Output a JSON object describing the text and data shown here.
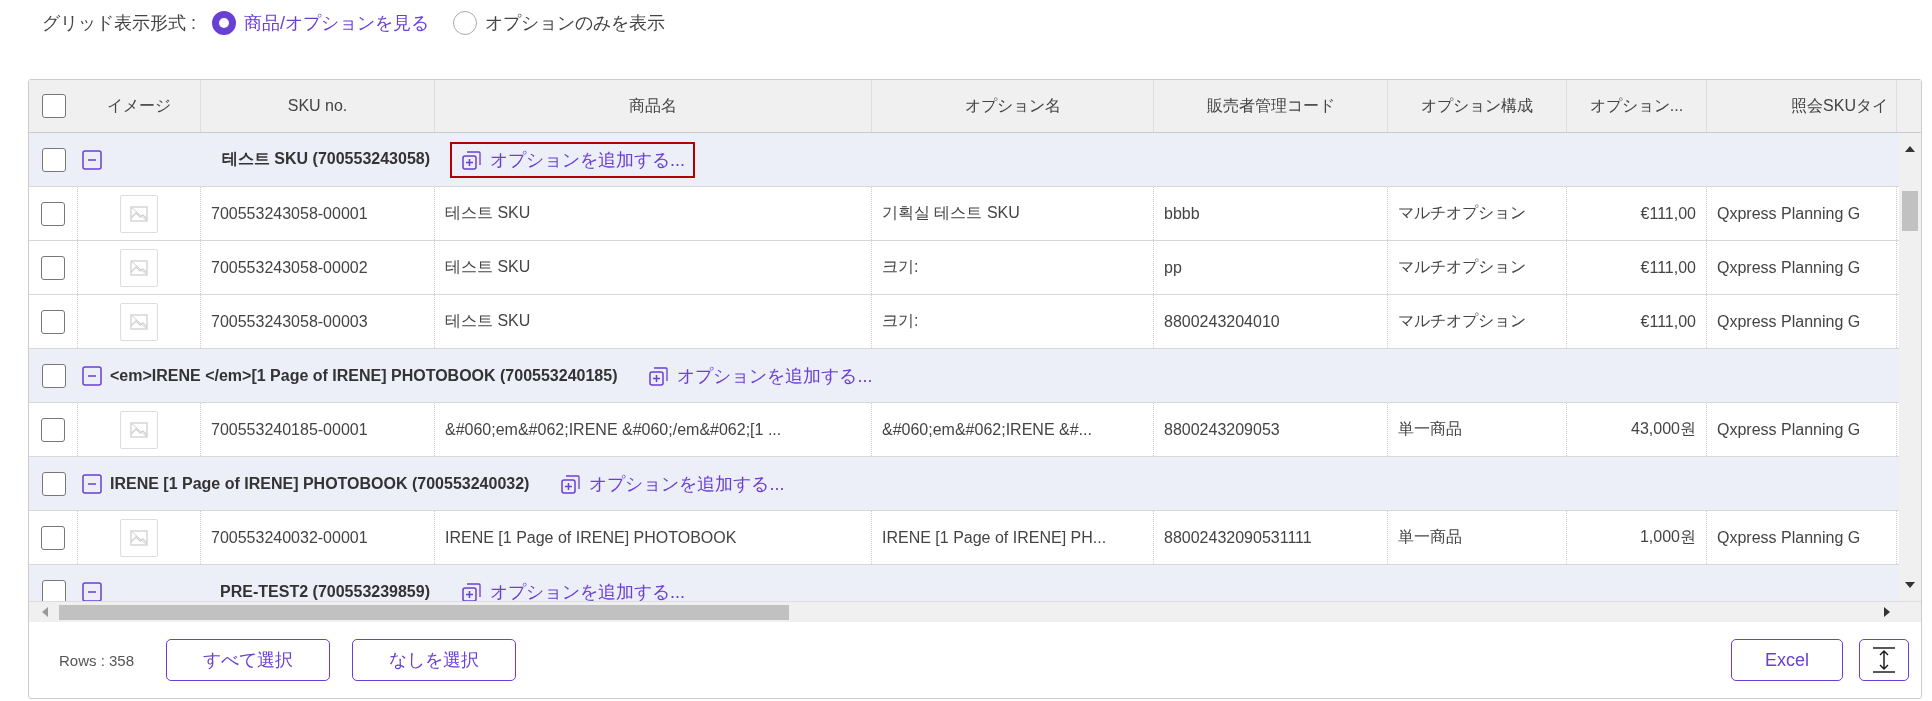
{
  "view_mode": {
    "label": "グリッド表示形式 :",
    "options": [
      {
        "label": "商品/オプションを見る",
        "selected": true
      },
      {
        "label": "オプションのみを表示",
        "selected": false
      }
    ]
  },
  "grid": {
    "header_checked": false,
    "columns": [
      "イメージ",
      "SKU no.",
      "商品名",
      "オプション名",
      "販売者管理コード",
      "オプション構成",
      "オプション...",
      "照会SKUタイ"
    ],
    "groups": [
      {
        "title": "테스트 SKU (700553243058)",
        "checked": false,
        "expanded": true,
        "add_option": "オプションを追加する...",
        "highlighted": true,
        "rows": [
          {
            "checked": false,
            "sku": "700553243058-00001",
            "product_name": "테스트 SKU",
            "option_name": "기획실 테스트 SKU",
            "seller_code": "bbbb",
            "option_type": "マルチオプション",
            "price": "€111,00",
            "sku_type": "Qxpress Planning G"
          },
          {
            "checked": false,
            "sku": "700553243058-00002",
            "product_name": "테스트 SKU",
            "option_name": "크기:",
            "seller_code": "pp",
            "option_type": "マルチオプション",
            "price": "€111,00",
            "sku_type": "Qxpress Planning G"
          },
          {
            "checked": false,
            "sku": "700553243058-00003",
            "product_name": "테스트 SKU",
            "option_name": "크기:",
            "seller_code": "8800243204010",
            "option_type": "マルチオプション",
            "price": "€111,00",
            "sku_type": "Qxpress Planning G"
          }
        ]
      },
      {
        "title": "<em>IRENE </em>[1 Page of IRENE] PHOTOBOOK (700553240185)",
        "checked": false,
        "expanded": true,
        "add_option": "オプションを追加する...",
        "highlighted": false,
        "rows": [
          {
            "checked": false,
            "sku": "700553240185-00001",
            "product_name": "&#060;em&#062;IRENE &#060;/em&#062;[1 ...",
            "option_name": "&#060;em&#062;IRENE &#...",
            "seller_code": "8800243209053",
            "option_type": "単一商品",
            "price": "43,000원",
            "sku_type": "Qxpress Planning G"
          }
        ]
      },
      {
        "title": "IRENE [1 Page of IRENE] PHOTOBOOK (700553240032)",
        "checked": false,
        "expanded": true,
        "add_option": "オプションを追加する...",
        "highlighted": false,
        "rows": [
          {
            "checked": false,
            "sku": "700553240032-00001",
            "product_name": "IRENE [1 Page of IRENE] PHOTOBOOK",
            "option_name": "IRENE [1 Page of IRENE] PH...",
            "seller_code": "88002432090531111",
            "option_type": "単一商品",
            "price": "1,000원",
            "sku_type": "Qxpress Planning G"
          }
        ]
      },
      {
        "title": "PRE-TEST2 (700553239859)",
        "checked": false,
        "expanded": true,
        "add_option": "オプションを追加する...",
        "highlighted": false
      }
    ]
  },
  "footer": {
    "rows_count": "Rows : 358",
    "buttons": [
      "すべて選択",
      "なしを選択"
    ],
    "export": "Excel"
  }
}
